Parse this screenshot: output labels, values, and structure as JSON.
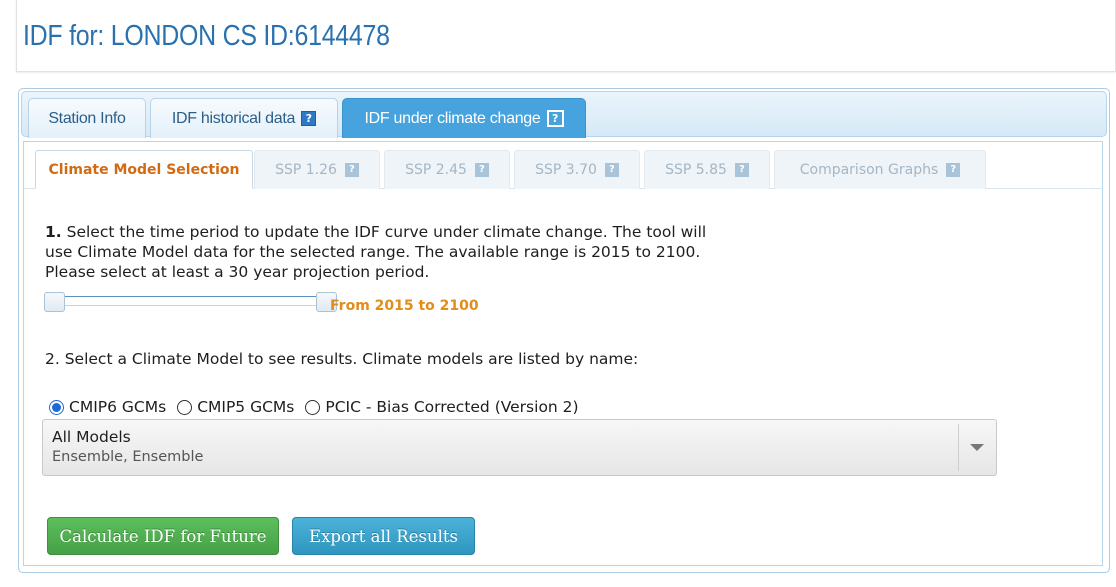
{
  "header": {
    "title": "IDF for: LONDON CS ID:6144478"
  },
  "outer_tabs": [
    {
      "label": "Station Info",
      "help": ""
    },
    {
      "label": "IDF historical data",
      "help": "?"
    },
    {
      "label": "IDF under climate change",
      "help": "?"
    }
  ],
  "outer_tabs_active_index": 2,
  "inner_tabs": [
    {
      "label": "Climate Model Selection",
      "help": ""
    },
    {
      "label": "SSP 1.26",
      "help": "?"
    },
    {
      "label": "SSP 2.45",
      "help": "?"
    },
    {
      "label": "SSP 3.70",
      "help": "?"
    },
    {
      "label": "SSP 5.85",
      "help": "?"
    },
    {
      "label": "Comparison Graphs",
      "help": "?"
    }
  ],
  "inner_tabs_active_index": 0,
  "step1": {
    "number": "1.",
    "text": "Select the time period to update the IDF curve under climate change. The tool will use Climate Model data for the selected range. The available range is 2015 to 2100. Please select at least a 30 year projection period.",
    "range_label": "From 2015 to 2100",
    "range_start": 2015,
    "range_end": 2100
  },
  "step2": {
    "text": "2. Select a Climate Model to see results. Climate models are listed by name:"
  },
  "model_source_options": [
    {
      "label": "CMIP6 GCMs",
      "checked": true
    },
    {
      "label": "CMIP5 GCMs",
      "checked": false
    },
    {
      "label": "PCIC - Bias Corrected (Version 2)",
      "checked": false
    }
  ],
  "model_select": {
    "selected_main": "All Models",
    "selected_sub": "Ensemble, Ensemble"
  },
  "buttons": {
    "calculate": "Calculate IDF for Future",
    "export": "Export all Results"
  },
  "colors": {
    "title": "#2a71b0",
    "active_outer_tab": "#47a3dd",
    "active_inner_tab_text": "#d26a12",
    "range_label": "#e28c1a",
    "calculate_button": "#46a046",
    "export_button": "#2f96c0"
  }
}
